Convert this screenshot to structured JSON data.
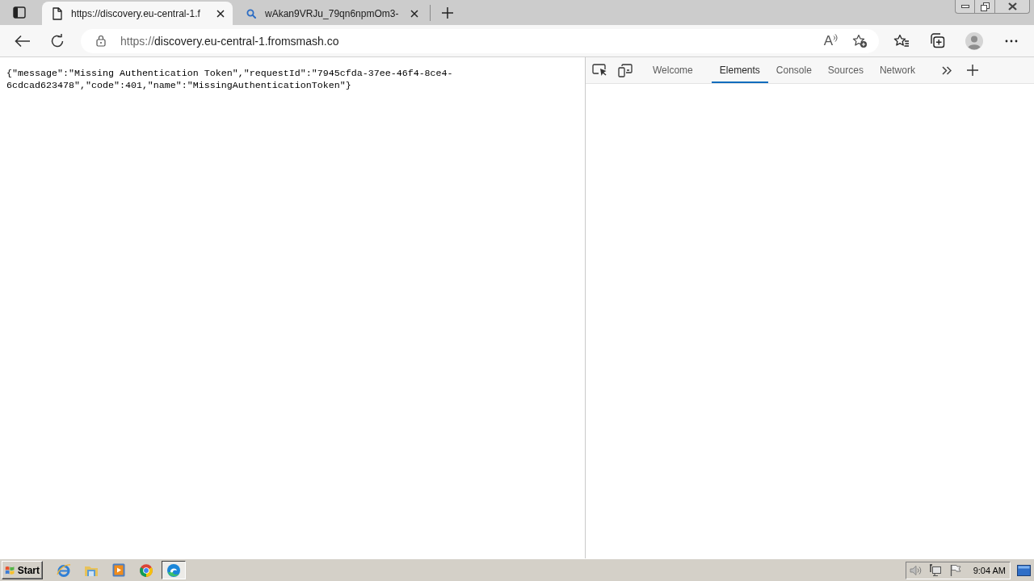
{
  "browser_tabs": [
    {
      "title": "https://discovery.eu-central-1.f",
      "kind": "page",
      "selected": true
    },
    {
      "title": "wAkan9VRJu_79qn6npmOm3-",
      "kind": "search",
      "selected": false
    }
  ],
  "address_bar": {
    "scheme": "https://",
    "host": "discovery.eu-central-1.fromsmash.co",
    "read_aloud_glyph": "A"
  },
  "page": {
    "text": "{\"message\":\"Missing Authentication Token\",\"requestId\":\"7945cfda-37ee-46f4-8ce4-6cdcad623478\",\"code\":401,\"name\":\"MissingAuthenticationToken\"}"
  },
  "devtools": {
    "tabs": [
      {
        "label": "Welcome",
        "selected": false
      },
      {
        "label": "Elements",
        "selected": true
      },
      {
        "label": "Console",
        "selected": false
      },
      {
        "label": "Sources",
        "selected": false
      },
      {
        "label": "Network",
        "selected": false
      }
    ]
  },
  "taskbar": {
    "start": "Start",
    "apps": [
      {
        "kind": "ie",
        "selected": false
      },
      {
        "kind": "explorer",
        "selected": false
      },
      {
        "kind": "media",
        "selected": false
      },
      {
        "kind": "chrome",
        "selected": false
      },
      {
        "kind": "edge",
        "selected": true
      }
    ],
    "clock": "9:04 AM"
  }
}
